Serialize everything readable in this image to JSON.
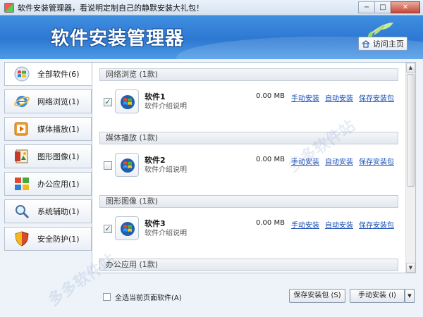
{
  "window": {
    "title": "软件安装管理器，看说明定制自己的静默安装大礼包！",
    "min_label": "−",
    "max_label": "□",
    "close_label": "✕"
  },
  "banner": {
    "title": "软件安装管理器",
    "home_label": "访问主页"
  },
  "sidebar": {
    "items": [
      {
        "label": "全部软件(6)",
        "icon": "windows-logo-icon",
        "active": true
      },
      {
        "label": "网络浏览(1)",
        "icon": "ie-browser-icon"
      },
      {
        "label": "媒体播放(1)",
        "icon": "media-player-icon"
      },
      {
        "label": "图形图像(1)",
        "icon": "image-editor-icon"
      },
      {
        "label": "办公应用(1)",
        "icon": "office-grid-icon"
      },
      {
        "label": "系统辅助(1)",
        "icon": "magnifier-icon"
      },
      {
        "label": "安全防护(1)",
        "icon": "security-shield-icon"
      }
    ]
  },
  "categories": [
    {
      "label": "网络浏览 (1款)"
    },
    {
      "label": "媒体播放 (1款)"
    },
    {
      "label": "图形图像 (1款)"
    },
    {
      "label": "办公应用 (1款)"
    }
  ],
  "software": [
    {
      "name": "软件1",
      "desc": "软件介绍说明",
      "size": "0.00 MB",
      "checked": true
    },
    {
      "name": "软件2",
      "desc": "软件介绍说明",
      "size": "0.00 MB",
      "checked": false
    },
    {
      "name": "软件3",
      "desc": "软件介绍说明",
      "size": "0.00 MB",
      "checked": true
    }
  ],
  "links": {
    "manual": "手动安装",
    "auto": "自动安装",
    "save": "保存安装包"
  },
  "bottom": {
    "select_all": "全选当前页面软件(A)",
    "save_btn": "保存安装包 (S)",
    "install_btn": "手动安装 (I)"
  },
  "watermark": "多多软件站",
  "colors": {
    "banner": "#2d78d2",
    "link": "#1a4fb5",
    "check": "#2a7a2a"
  }
}
